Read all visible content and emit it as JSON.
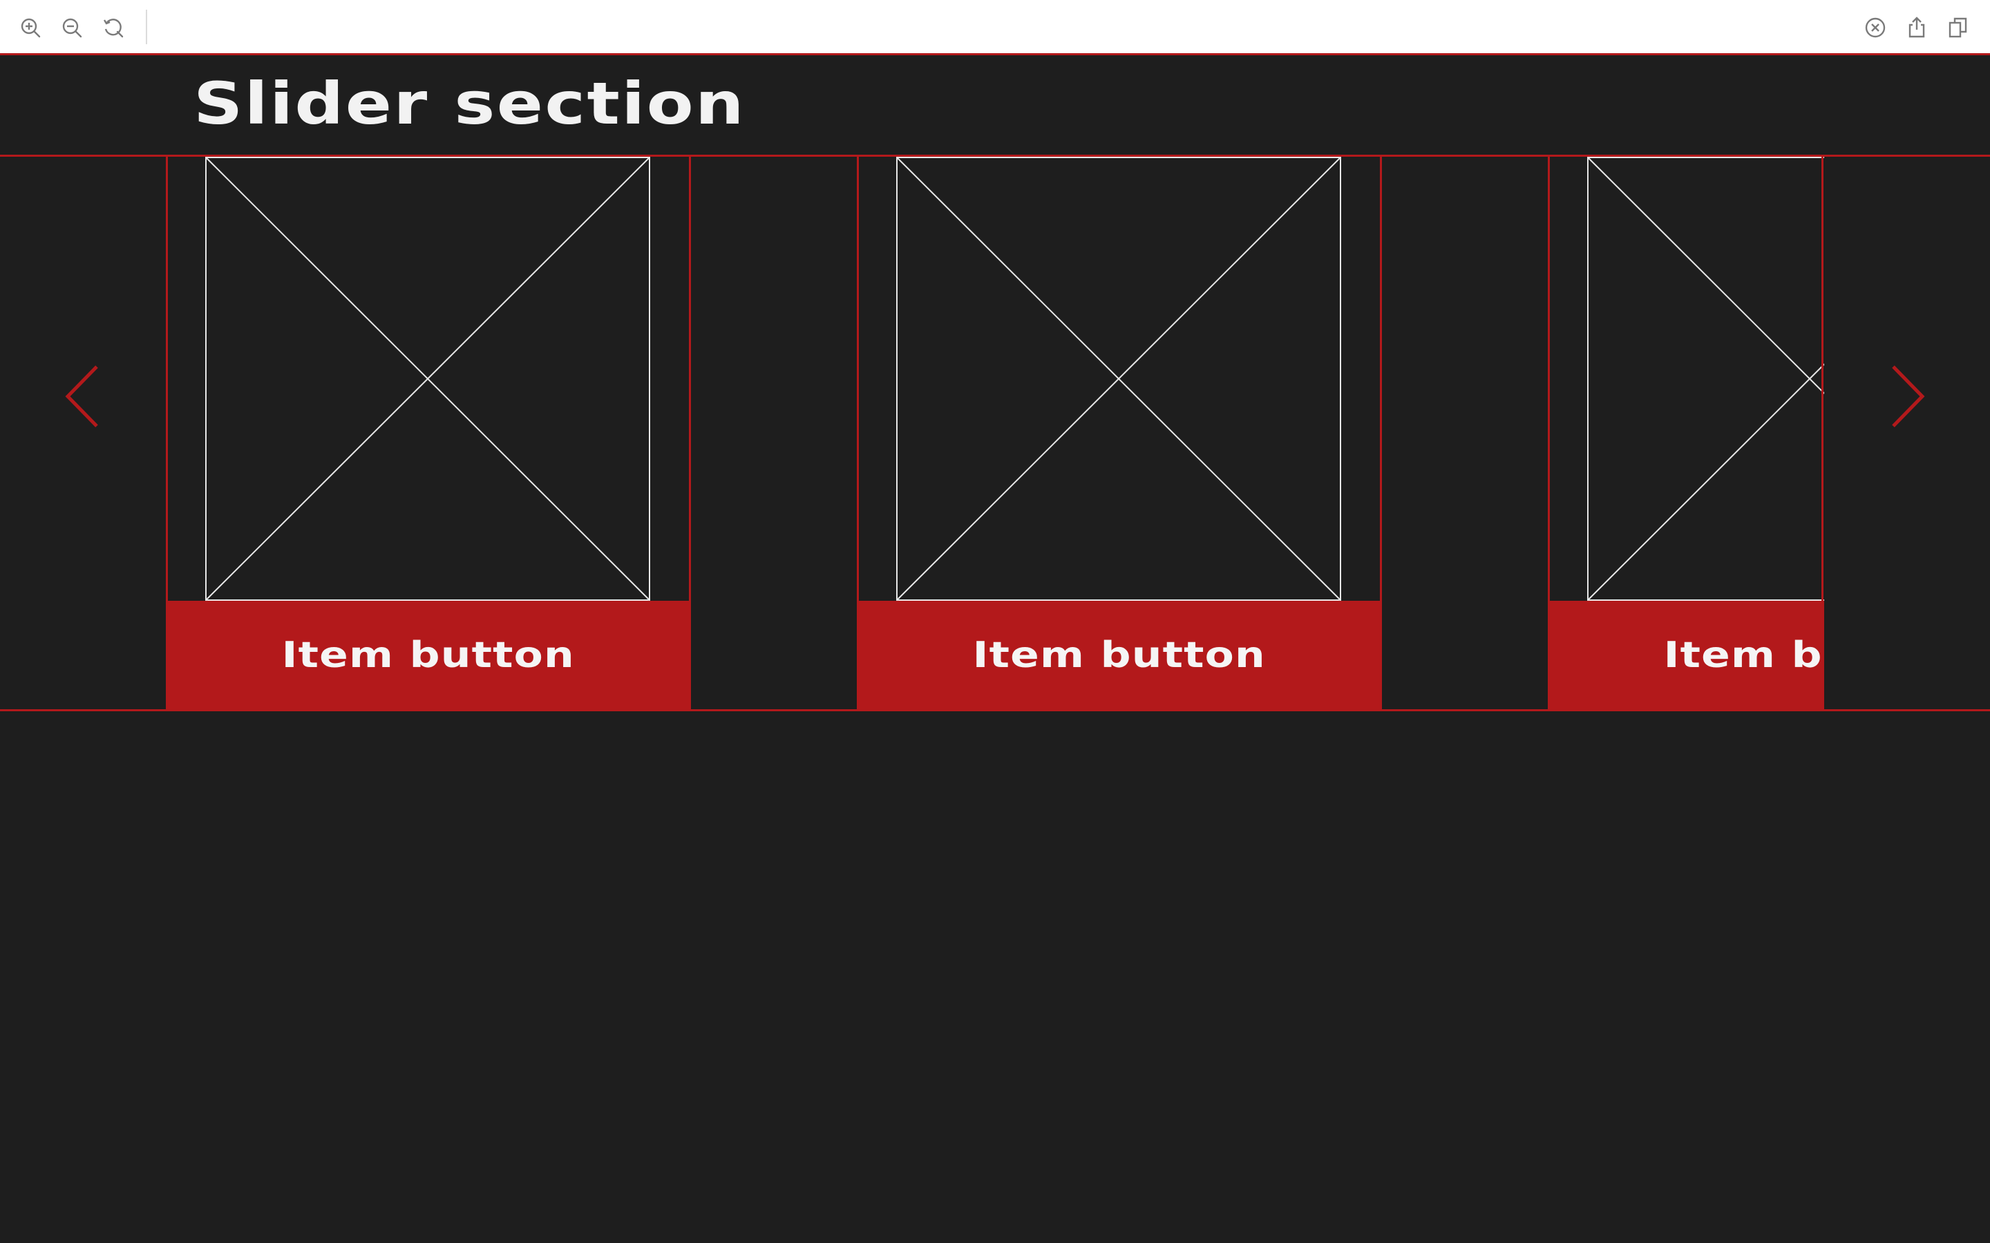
{
  "toolbar": {
    "left_icons": [
      "zoom-in-icon",
      "zoom-out-icon",
      "reset-zoom-icon"
    ],
    "right_icons": [
      "close-circle-icon",
      "share-icon",
      "copy-icon"
    ]
  },
  "section": {
    "title": "Slider section"
  },
  "slider": {
    "prev_icon": "chevron-left-icon",
    "next_icon": "chevron-right-icon",
    "items": [
      {
        "image": "image-placeholder",
        "button_label": "Item button"
      },
      {
        "image": "image-placeholder",
        "button_label": "Item button"
      },
      {
        "image": "image-placeholder",
        "button_label": "Item button"
      }
    ]
  },
  "colors": {
    "background": "#1e1e1e",
    "accent": "#b3191b",
    "text": "#f2f2f2",
    "toolbar": "#ffffff"
  }
}
